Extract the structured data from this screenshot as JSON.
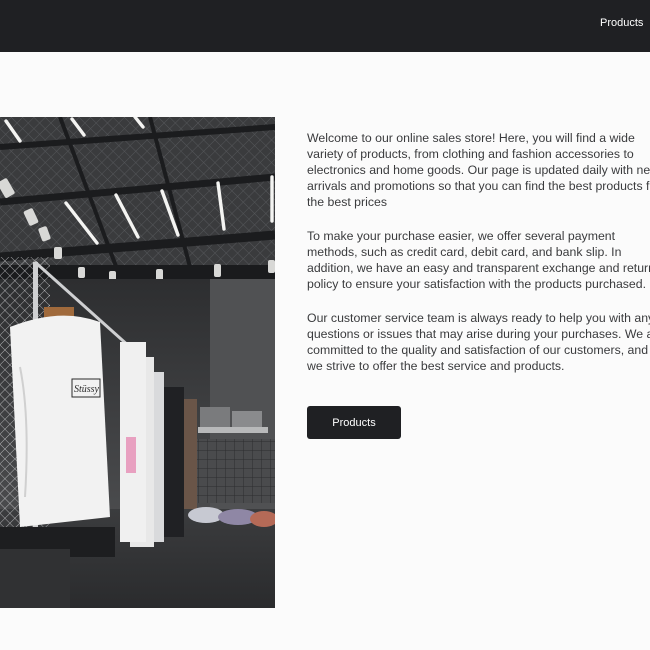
{
  "header": {
    "nav_products": "Products"
  },
  "main": {
    "image_label": "store-interior-photo",
    "paragraphs": [
      "Welcome to our online sales store! Here, you will find a wide variety of products, from clothing and fashion accessories to electronics and home goods. Our page is updated daily with new arrivals and promotions so that you can find the best products for the best prices",
      "To make your purchase easier, we offer several payment methods, such as credit card, debit card, and bank slip. In addition, we have an easy and transparent exchange and return policy to ensure your satisfaction with the products purchased.",
      "Our customer service team is always ready to help you with any questions or issues that may arise during your purchases. We are committed to the quality and satisfaction of our customers, and we strive to offer the best service and products."
    ],
    "cta_label": "Products"
  },
  "colors": {
    "header_bg": "#1f2023",
    "page_bg": "#fbfbfb",
    "text": "#3a3b3d",
    "button_bg": "#1f2023"
  }
}
